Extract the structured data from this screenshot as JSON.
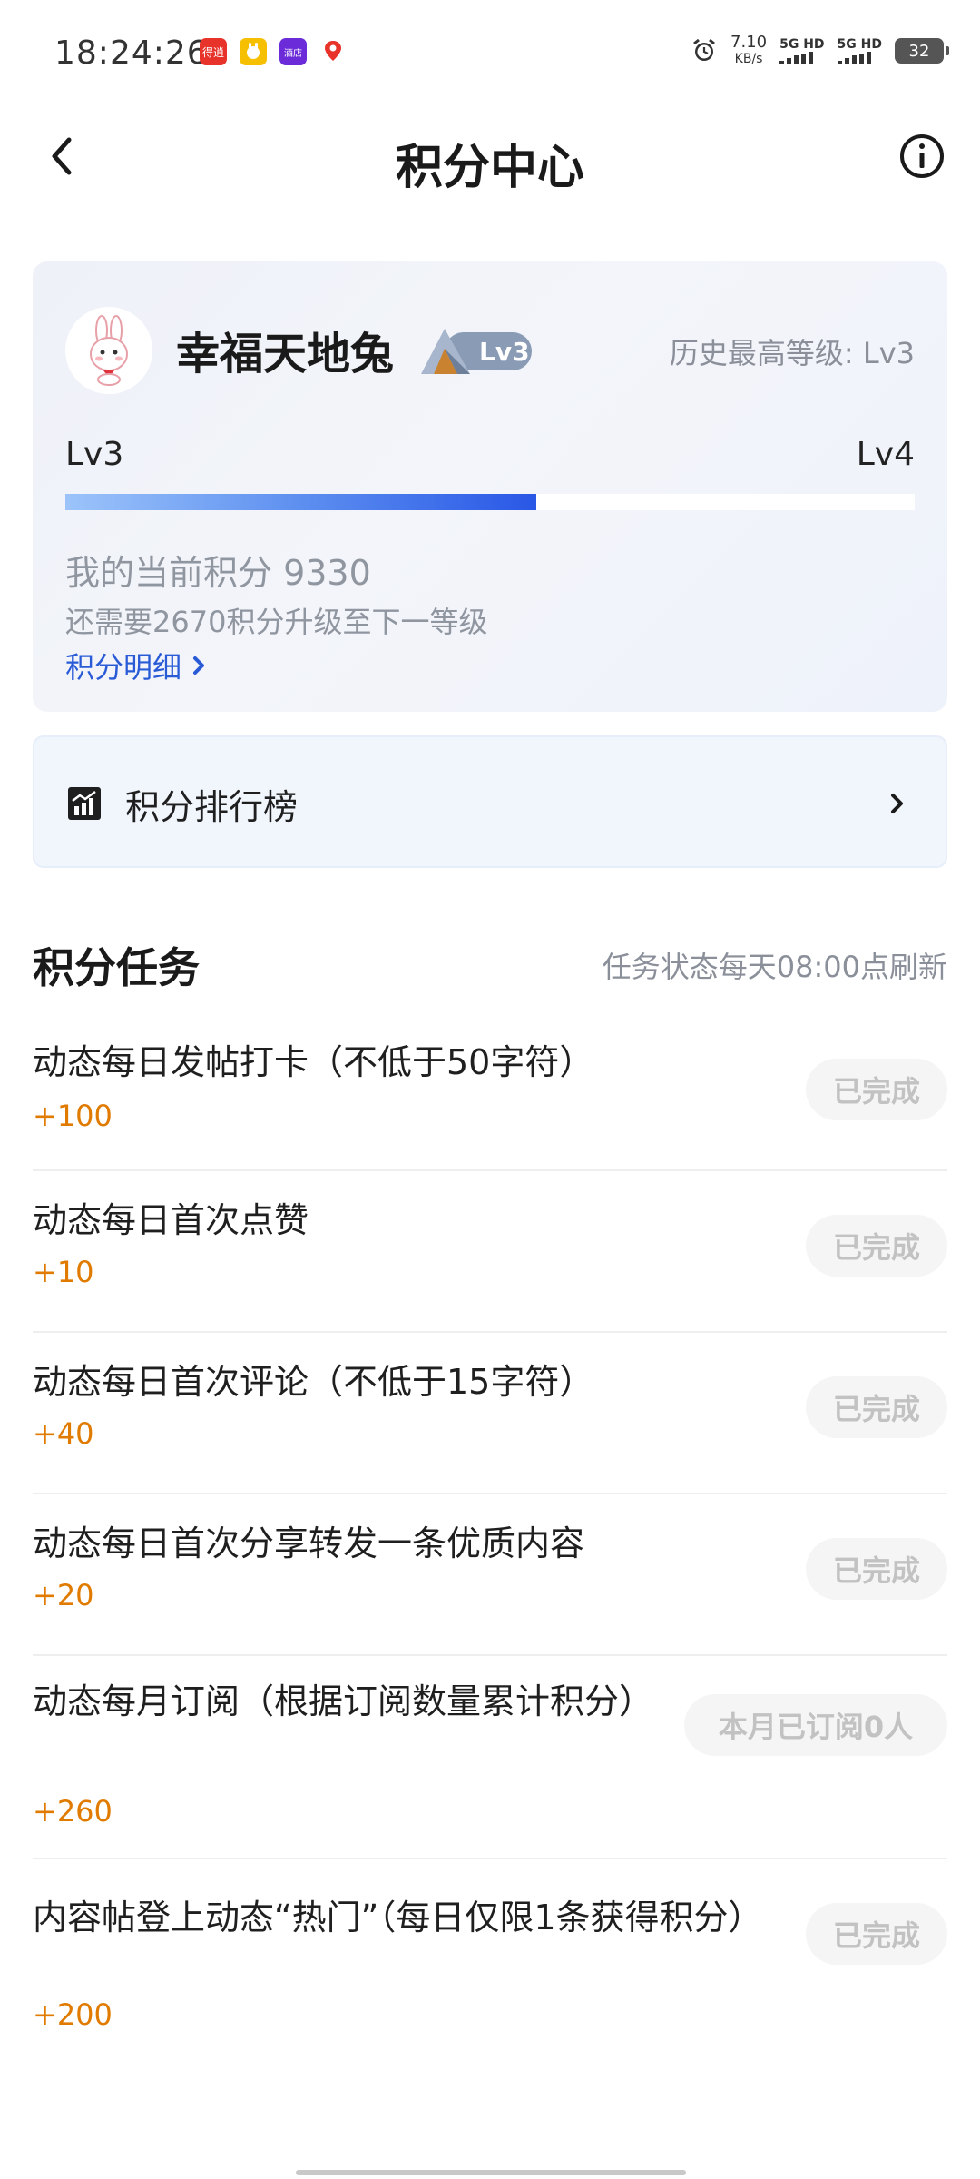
{
  "status_bar": {
    "time": "18:24:26",
    "net_speed": "7.10",
    "net_speed_unit": "KB/s",
    "sim1": "5G HD",
    "sim2": "5G HD",
    "battery": "32",
    "app_icons": [
      {
        "name": "app-icon-1",
        "color": "#e8332a",
        "text": "得逍"
      },
      {
        "name": "app-icon-2",
        "color": "#f6c000",
        "text": ""
      },
      {
        "name": "app-icon-3",
        "color": "#6b2bd9",
        "text": "酒店"
      },
      {
        "name": "app-icon-4",
        "color": "#ffffff",
        "text": ""
      }
    ]
  },
  "header": {
    "title": "积分中心"
  },
  "level_card": {
    "username": "幸福天地兔",
    "badge": "Lv3",
    "history_level": "历史最高等级: Lv3",
    "current_level": "Lv3",
    "next_level": "Lv4",
    "progress_fraction": 0.555,
    "current_points": "我的当前积分 9330",
    "need_points": "还需要2670积分升级至下一等级",
    "detail_link": "积分明细"
  },
  "ranking": {
    "label": "积分排行榜"
  },
  "tasks": {
    "title": "积分任务",
    "refresh_note": "任务状态每天08:00点刷新",
    "items": [
      {
        "name": "动态每日发帖打卡（不低于50字符）",
        "reward": "+100",
        "status": "已完成"
      },
      {
        "name": "动态每日首次点赞",
        "reward": "+10",
        "status": "已完成"
      },
      {
        "name": "动态每日首次评论（不低于15字符）",
        "reward": "+40",
        "status": "已完成"
      },
      {
        "name": "动态每日首次分享转发一条优质内容",
        "reward": "+20",
        "status": "已完成"
      },
      {
        "name": "动态每月订阅（根据订阅数量累计积分）",
        "reward": "+260",
        "status": "本月已订阅0人"
      },
      {
        "name": "内容帖登上动态“热门”（每日仅限1条获得积分）",
        "reward": "+200",
        "status": "已完成"
      }
    ]
  },
  "colors": {
    "accent_blue": "#2a5bd7",
    "reward_orange": "#e07b00",
    "progress_start": "#9cc4fa",
    "progress_end": "#2957e6"
  }
}
